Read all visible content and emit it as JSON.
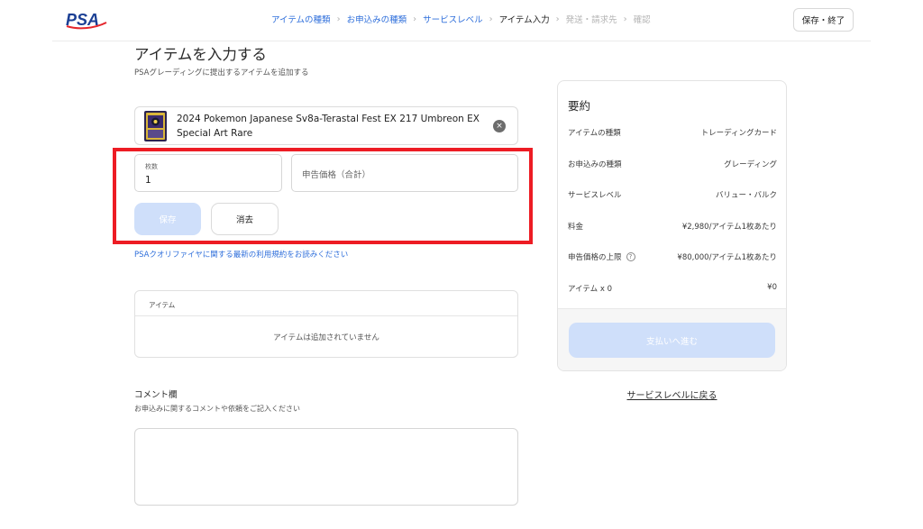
{
  "header": {
    "logo_text": "PSA",
    "breadcrumb": [
      {
        "label": "アイテムの種類",
        "state": "done"
      },
      {
        "label": "お申込みの種類",
        "state": "done"
      },
      {
        "label": "サービスレベル",
        "state": "done"
      },
      {
        "label": "アイテム入力",
        "state": "current"
      },
      {
        "label": "発送・請求先",
        "state": "future"
      },
      {
        "label": "確認",
        "state": "future"
      }
    ],
    "separator": "›",
    "save_exit_label": "保存・終了"
  },
  "main": {
    "title": "アイテムを入力する",
    "subtitle": "PSAグレーディングに提出するアイテムを追加する",
    "item": {
      "name": "2024 Pokemon Japanese Sv8a-Terastal Fest EX 217 Umbreon EX Special Art Rare",
      "remove_icon": "×"
    },
    "form": {
      "quantity_label": "枚数",
      "quantity_value": "1",
      "declared_value_placeholder": "申告価格（合計）",
      "save_label": "保存",
      "clear_label": "消去"
    },
    "terms_link": "PSAクオリファイヤに関する最新の利用規約をお読みください",
    "items_table": {
      "header": "アイテム",
      "empty_message": "アイテムは追加されていません"
    },
    "comment": {
      "title": "コメント欄",
      "subtitle": "お申込みに関するコメントや依頼をご記入ください",
      "value": ""
    }
  },
  "summary": {
    "title": "要約",
    "rows": [
      {
        "label": "アイテムの種類",
        "value": "トレーディングカード"
      },
      {
        "label": "お申込みの種類",
        "value": "グレーディング"
      },
      {
        "label": "サービスレベル",
        "value": "バリュー・バルク"
      },
      {
        "label": "料金",
        "value": "¥2,980/アイテム1枚あたり"
      },
      {
        "label": "申告価格の上限",
        "value": "¥80,000/アイテム1枚あたり",
        "help_icon": "?"
      },
      {
        "label": "アイテム x 0",
        "value": "¥0"
      }
    ],
    "pay_label": "支払いへ進む",
    "back_link": "サービスレベルに戻る"
  },
  "colors": {
    "accent": "#2f6fdb",
    "disabled_button": "#cfdffa",
    "highlight": "#ed1c24",
    "logo_blue": "#1b3f94",
    "logo_red": "#e4252b"
  }
}
